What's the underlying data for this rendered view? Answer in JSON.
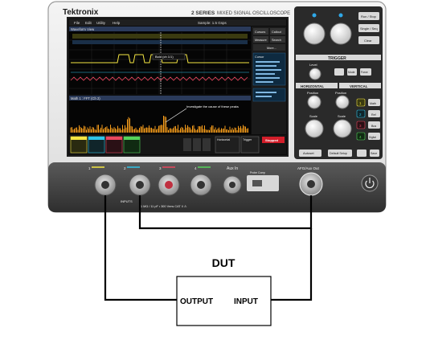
{
  "scope": {
    "brand": "Tektronix",
    "model": "2 SERIES",
    "model_desc": "MIXED SIGNAL OSCILLOSCOPE",
    "menu": [
      "File",
      "Edit",
      "Utility",
      "Help"
    ],
    "waveform_view_label": "Waveform View",
    "sample_rate_label": "Sample: 1.5 Gsps",
    "cursors_button": "Cursors",
    "callout_button": "Callout",
    "measure_button": "Measure",
    "search_button": "Search",
    "more_button": "More...",
    "cursor_label": "Cursor",
    "callout_text": "Bold (ch 1/1)",
    "math_view_label": "Math 1 : FFT (Ch 2)",
    "annotation_text": "Investigate the cause of these peaks",
    "stopped_badge": "Stopped",
    "horizontal_label": "Horizontal",
    "trigger_label": "Trigger",
    "run_stop_button": "Run / Stop",
    "single_seq_button": "Single / Seq",
    "clear_button": "Clear",
    "trigger_section": "TRIGGER",
    "level_label": "Level",
    "mode_label": "Mode",
    "force_label": "Force",
    "horizontal_section": "HORIZONTAL",
    "vertical_section": "VERTICAL",
    "position_label": "Position",
    "scale_label": "Scale",
    "math_button": "Math",
    "ref_button": "Ref",
    "bus_button": "Bus",
    "digital_button": "Digital",
    "autoset_button": "Autoset",
    "default_setup_button": "Default Setup",
    "save_button": "Save",
    "channel_numbers": [
      "1",
      "2",
      "3",
      "4"
    ],
    "aux_in_label": "Aux In",
    "afg_label": "AFG/Aux Out",
    "inputs_label": "INPUTS",
    "inputs_spec": "1 MΩ / 11 pF • 300 Vrms CAT II ⚠",
    "probe_comp_label": "Probe Comp"
  },
  "diagram": {
    "dut_label": "DUT",
    "output_label": "OUTPUT",
    "input_label": "INPUT"
  },
  "colors": {
    "ch1": "#f5e642",
    "ch2": "#2fc4e8",
    "ch3": "#e8475e",
    "ch4": "#55d35a",
    "fft": "#f29a1a",
    "wire": "#000000"
  }
}
